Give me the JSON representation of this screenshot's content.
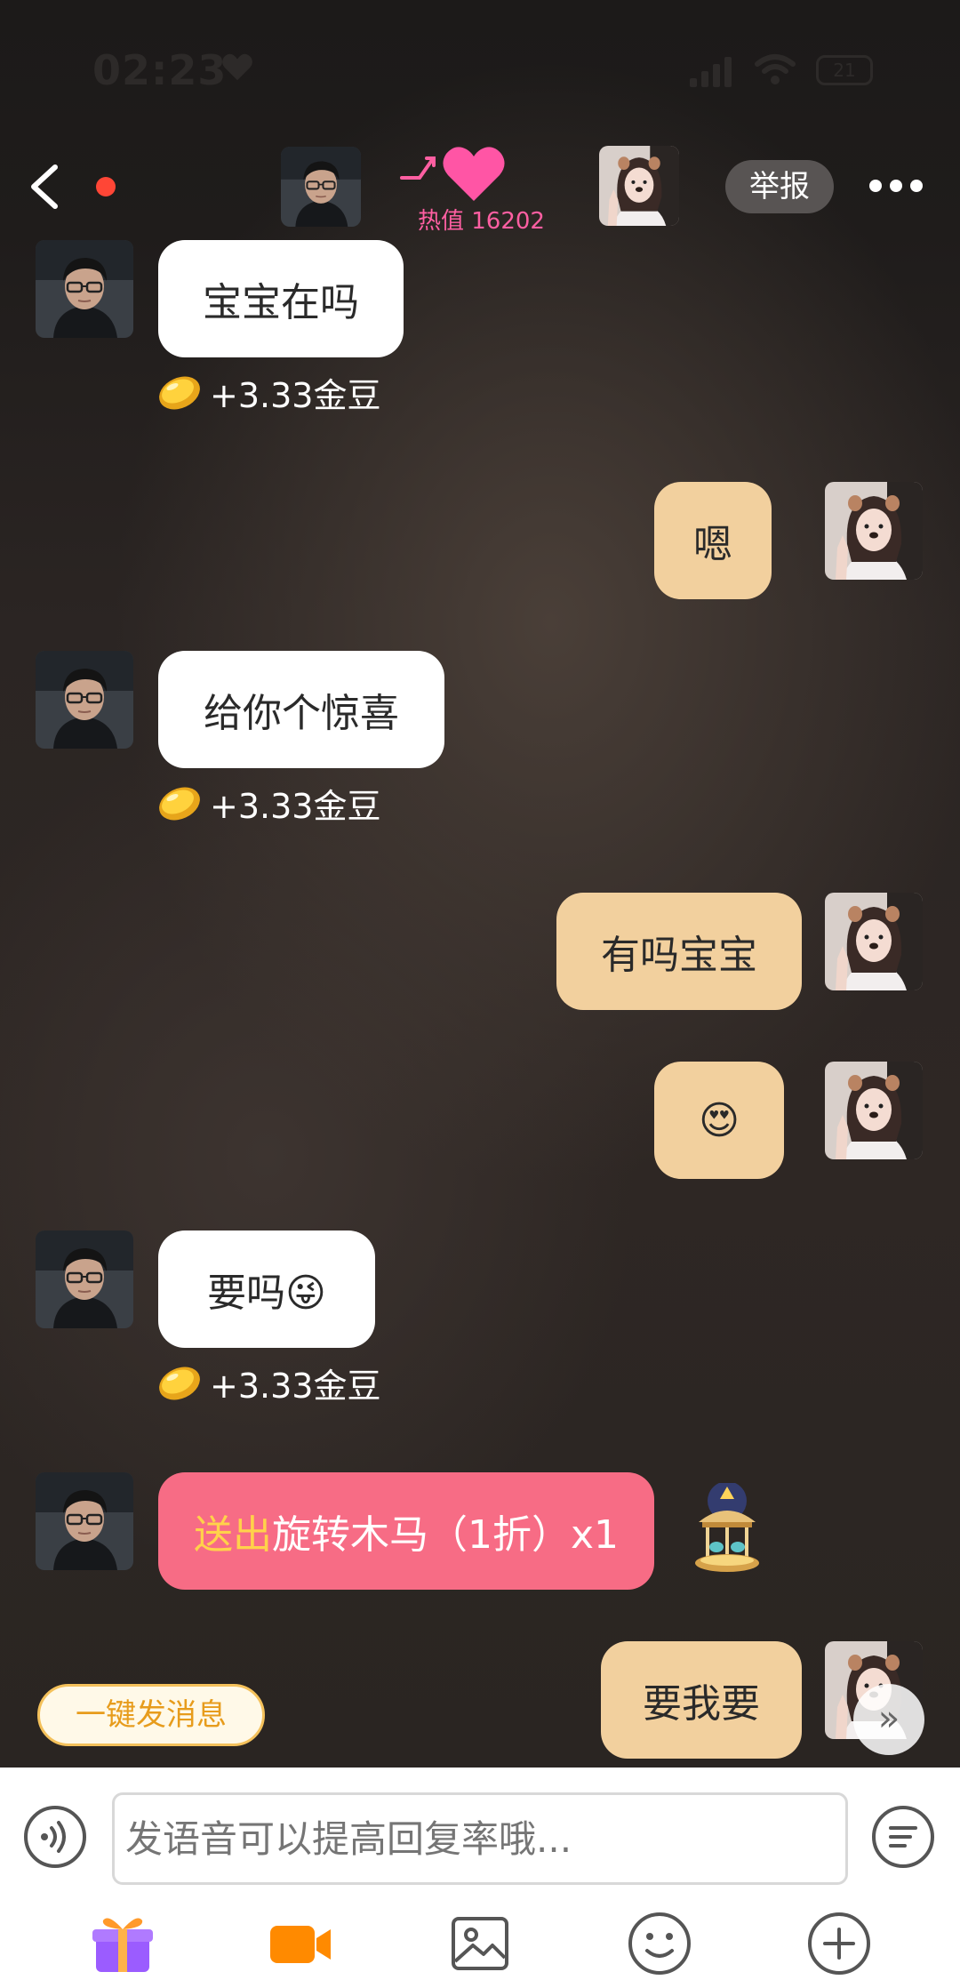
{
  "status_bar": {
    "time": "02:23",
    "battery": "21"
  },
  "header": {
    "heat_label": "热值 16202",
    "report_label": "举报"
  },
  "messages": [
    {
      "side": "left",
      "text": "宝宝在吗",
      "reward": "+3.33金豆"
    },
    {
      "side": "right",
      "text": "嗯"
    },
    {
      "side": "left",
      "text": "给你个惊喜",
      "reward": "+3.33金豆"
    },
    {
      "side": "right",
      "text": "有吗宝宝"
    },
    {
      "side": "right",
      "text": "😍"
    },
    {
      "side": "left",
      "text": "要吗😜",
      "reward": "+3.33金豆"
    },
    {
      "side": "left",
      "type": "gift",
      "highlight": "送出",
      "text": "旋转木马（1折）x1",
      "gift_icon": "carousel-icon"
    },
    {
      "side": "right",
      "text": "要我要"
    }
  ],
  "quick_action": {
    "label": "一键发消息",
    "scroll_glyph": "»"
  },
  "input": {
    "placeholder": "发语音可以提高回复率哦..."
  },
  "toolbar": [
    "gift-icon",
    "video-call-icon",
    "image-icon",
    "emoji-icon",
    "plus-icon"
  ],
  "colors": {
    "peach_bubble": "#f2d09e",
    "gift_bubble": "#f76c85",
    "heat_pink": "#ff5fa2",
    "accent_orange": "#ff8a00",
    "accent_purple": "#8a4dff"
  }
}
